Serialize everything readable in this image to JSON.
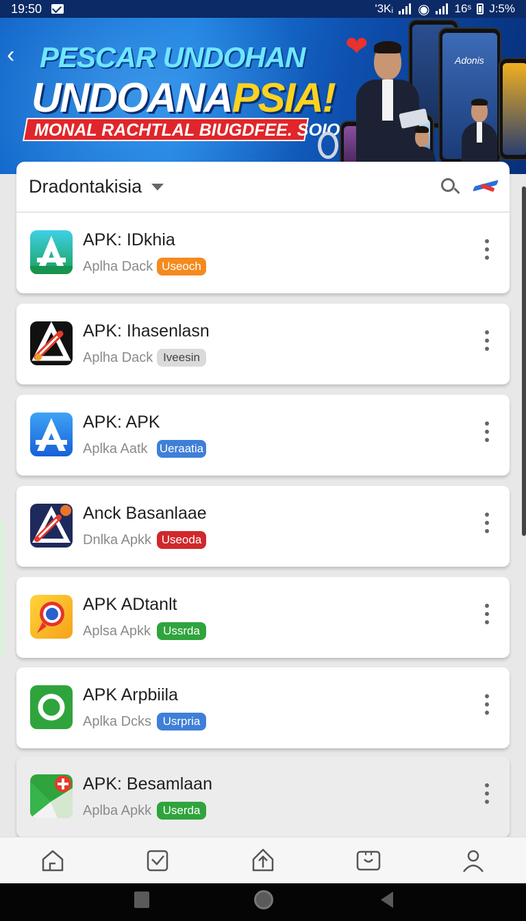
{
  "status_bar": {
    "time": "19:50",
    "right_text_1": "'3Kᵢ",
    "right_text_2": "16ˢ",
    "battery": "J:5%"
  },
  "banner": {
    "title_line1": "PESCAR UNDOHAN",
    "title_line2_main": "UNDOANA",
    "title_line2_highlight": "PSIA!",
    "subtitle": "MONAL RACHTLAL BIUGDFEE. SOIO",
    "phone_screen_text": "Adonis"
  },
  "list_header": {
    "title": "Dradontakisia"
  },
  "apps": [
    {
      "title": "APK: IDkhia",
      "subtitle": "Aplha Dack",
      "badge": "Useoch",
      "badge_color": "#f58a1f",
      "icon": "a-triangle-green-icon"
    },
    {
      "title": "APK: Ihasenlasn",
      "subtitle": "Aplha Dack",
      "badge": "Iveesin",
      "badge_color": "#dadada",
      "icon": "rocket-black-icon"
    },
    {
      "title": "APK: APK",
      "subtitle": "Aplka Aatk",
      "badge": "Ueraatia",
      "badge_color": "#3f7fd8",
      "icon": "a-triangle-blue-icon"
    },
    {
      "title": "Anck Basanlaae",
      "subtitle": "Dnlka Apkk",
      "badge": "Useoda",
      "badge_color": "#d0282c",
      "icon": "rocket-navy-icon"
    },
    {
      "title": "APK ADtanlt",
      "subtitle": "Aplsa Apkk",
      "badge": "Ussrda",
      "badge_color": "#2fa43c",
      "icon": "location-pin-icon"
    },
    {
      "title": "APK Arpbiila",
      "subtitle": "Aplka Dcks",
      "badge": "Usrpria",
      "badge_color": "#3f7fd8",
      "icon": "green-ring-icon"
    },
    {
      "title": "APK: Besamlaan",
      "subtitle": "Aplba Apkk",
      "badge": "Userda",
      "badge_color": "#2fa43c",
      "icon": "map-plus-icon"
    }
  ],
  "bottom_nav": [
    "home-icon",
    "checkbox-icon",
    "upload-icon",
    "inbox-icon",
    "profile-icon"
  ]
}
